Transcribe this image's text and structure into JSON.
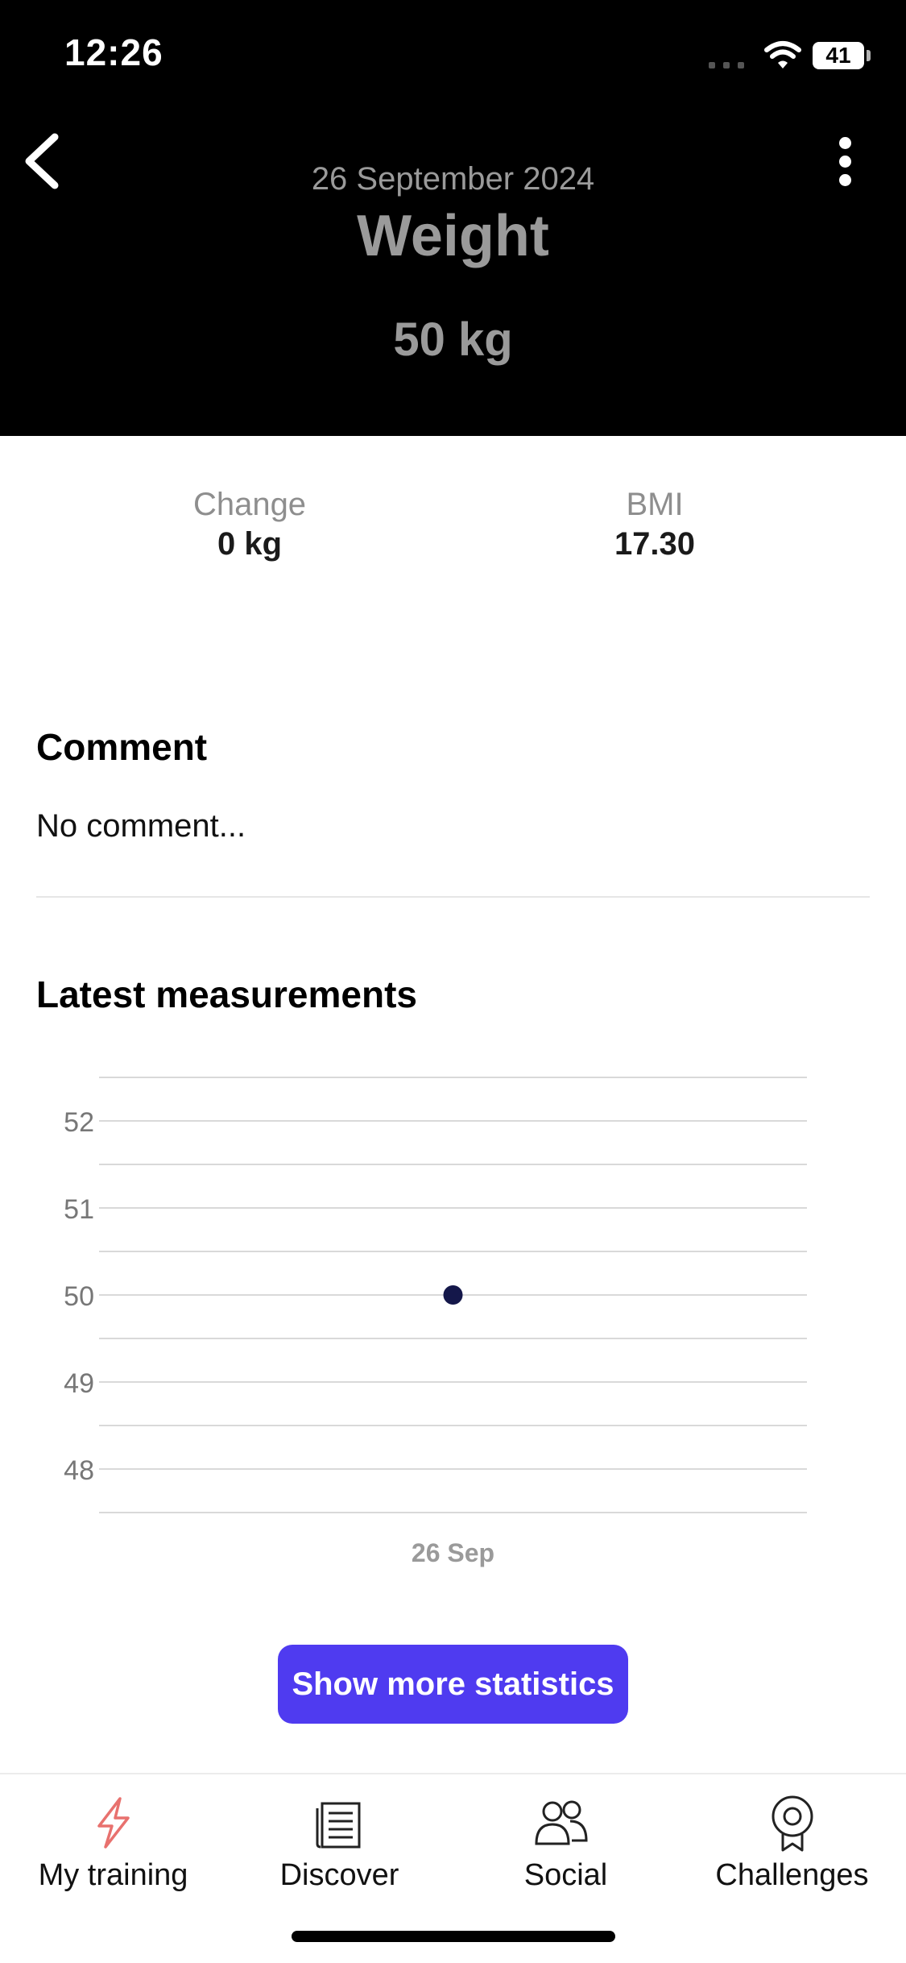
{
  "status_bar": {
    "time": "12:26",
    "battery": "41"
  },
  "header": {
    "date": "26 September 2024",
    "title": "Weight",
    "value": "50 kg"
  },
  "stats": {
    "change_label": "Change",
    "change_value": "0 kg",
    "bmi_label": "BMI",
    "bmi_value": "17.30"
  },
  "comment": {
    "title": "Comment",
    "text": "No comment..."
  },
  "measurements": {
    "title": "Latest measurements"
  },
  "chart_data": {
    "type": "scatter",
    "x": [
      "26 Sep"
    ],
    "values": [
      50
    ],
    "y_ticks": [
      52,
      51,
      50,
      49,
      48
    ],
    "ylim": [
      47.5,
      52.5
    ],
    "grid": true,
    "point_color": "#14174a"
  },
  "actions": {
    "show_more_label": "Show more statistics"
  },
  "tabbar": {
    "items": [
      {
        "label": "My training",
        "icon": "lightning-icon",
        "active": true
      },
      {
        "label": "Discover",
        "icon": "document-icon",
        "active": false
      },
      {
        "label": "Social",
        "icon": "people-icon",
        "active": false
      },
      {
        "label": "Challenges",
        "icon": "award-icon",
        "active": false
      }
    ]
  },
  "colors": {
    "accent": "#4f3bf0",
    "active_tab": "#e8716e",
    "header_bg": "#000000"
  }
}
